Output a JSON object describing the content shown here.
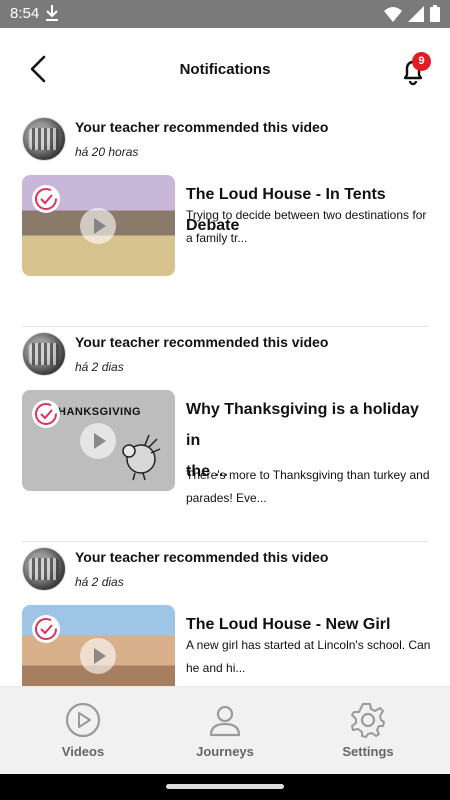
{
  "status_bar": {
    "time": "8:54"
  },
  "header": {
    "title": "Notifications",
    "badge_count": "9"
  },
  "notifications": [
    {
      "recommendation": "Your teacher recommended this video",
      "time": "há 20 horas",
      "video_title_line1": "The Loud House - In Tents Debate",
      "video_title_line2": "",
      "description_line1": "Trying to decide between two destinations for",
      "description_line2": "a family tr..."
    },
    {
      "recommendation": "Your teacher recommended this video",
      "time": "há 2 dias",
      "thumbnail_caption": "HANKSGIVING",
      "video_title_line1": "Why Thanksgiving is a holiday in",
      "video_title_line2": "the ...",
      "description_line1": "There's more to Thanksgiving than turkey and",
      "description_line2": "parades! Eve..."
    },
    {
      "recommendation": "Your teacher recommended this video",
      "time": "há 2 dias",
      "video_title_line1": "The Loud House - New Girl",
      "video_title_line2": "",
      "description_line1": "A new girl has started at Lincoln's school. Can",
      "description_line2": "he and hi..."
    }
  ],
  "bottom_nav": {
    "videos": "Videos",
    "journeys": "Journeys",
    "settings": "Settings"
  },
  "colors": {
    "badge": "#e31b23",
    "check_accent": "#e0305f",
    "nav_icon": "#9a9a9a"
  }
}
